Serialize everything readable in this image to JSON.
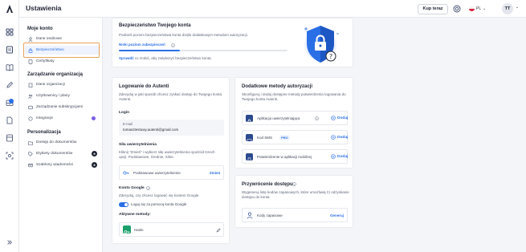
{
  "header": {
    "title": "Ustawienia",
    "buy_label": "Kup teraz",
    "lang": "PL",
    "avatar": "TT"
  },
  "menu": {
    "section1": "Moje konto",
    "items1": [
      "Dane osobowe",
      "Bezpieczeństwo",
      "Certyfikaty"
    ],
    "section2": "Zarządzanie organizacją",
    "items2": [
      "Dane organizacji",
      "Użytkownicy i plany",
      "Zarządzanie subskrypcjami",
      "Integracje"
    ],
    "section3": "Personalizacja",
    "items3": [
      "Dostęp do dokumentów",
      "Etykiety dokumentów",
      "Szablony wiadomości"
    ]
  },
  "security": {
    "title": "Bezpieczeństwo Twojego konta",
    "desc": "Podnieś poziom bezpieczeństwa konta dzięki dodatkowym metodom autoryzacji.",
    "level": "Niski poziom zabezpieczeń",
    "hint_link": "Sprawdź",
    "hint": " co zrobić, aby zwiększyć bezpieczeństwo konta.",
    "level_fraction": 0.36
  },
  "login": {
    "title": "Logowanie do Autenti",
    "desc": "Zdecyduj w jaki sposób chcesz zyskać dostęp do Twojego konta Autenti.",
    "login_label": "Login",
    "email_label": "E-mail",
    "email": "tomasztestowy.autenti@gmail.com",
    "auth_title": "Siła uwierzytelnienia",
    "auth_desc": "Kliknij \"Zmień\" i wybierz siłę uwierzytelnienia spośród trzech opcji: Podstawowe, Średnie, Silne.",
    "auth_value": "Podstawowe uwierzytelnienie",
    "auth_change": "Zmień",
    "google_title": "Konto Google",
    "google_desc": "Zdecyduj, czy chcesz logować się kontem Google.",
    "google_toggle": "Loguj się za pomocą konta Google",
    "active_title": "Aktywne metody:",
    "active_method": "Hasło"
  },
  "methods": {
    "title": "Dodatkowe metody autoryzacji",
    "desc": "Skonfiguruj i dodaj dostępne metody potwierdzenia logowania do Twojego konta Autenti.",
    "items": [
      "Aplikacja uwierzytelniająca",
      "Kod SMS",
      "Potwierdzenie w aplikacji mobilnej"
    ],
    "pro": "PRO",
    "add": "Dodaj"
  },
  "recovery": {
    "title": "Przywrócenie dostępu",
    "desc": "Wygeneruj listę kodów zapasowych, które umożliwią Ci odzyskanie dostępu do konta.",
    "item": "Kody zapasowe",
    "action": "Generuj"
  }
}
